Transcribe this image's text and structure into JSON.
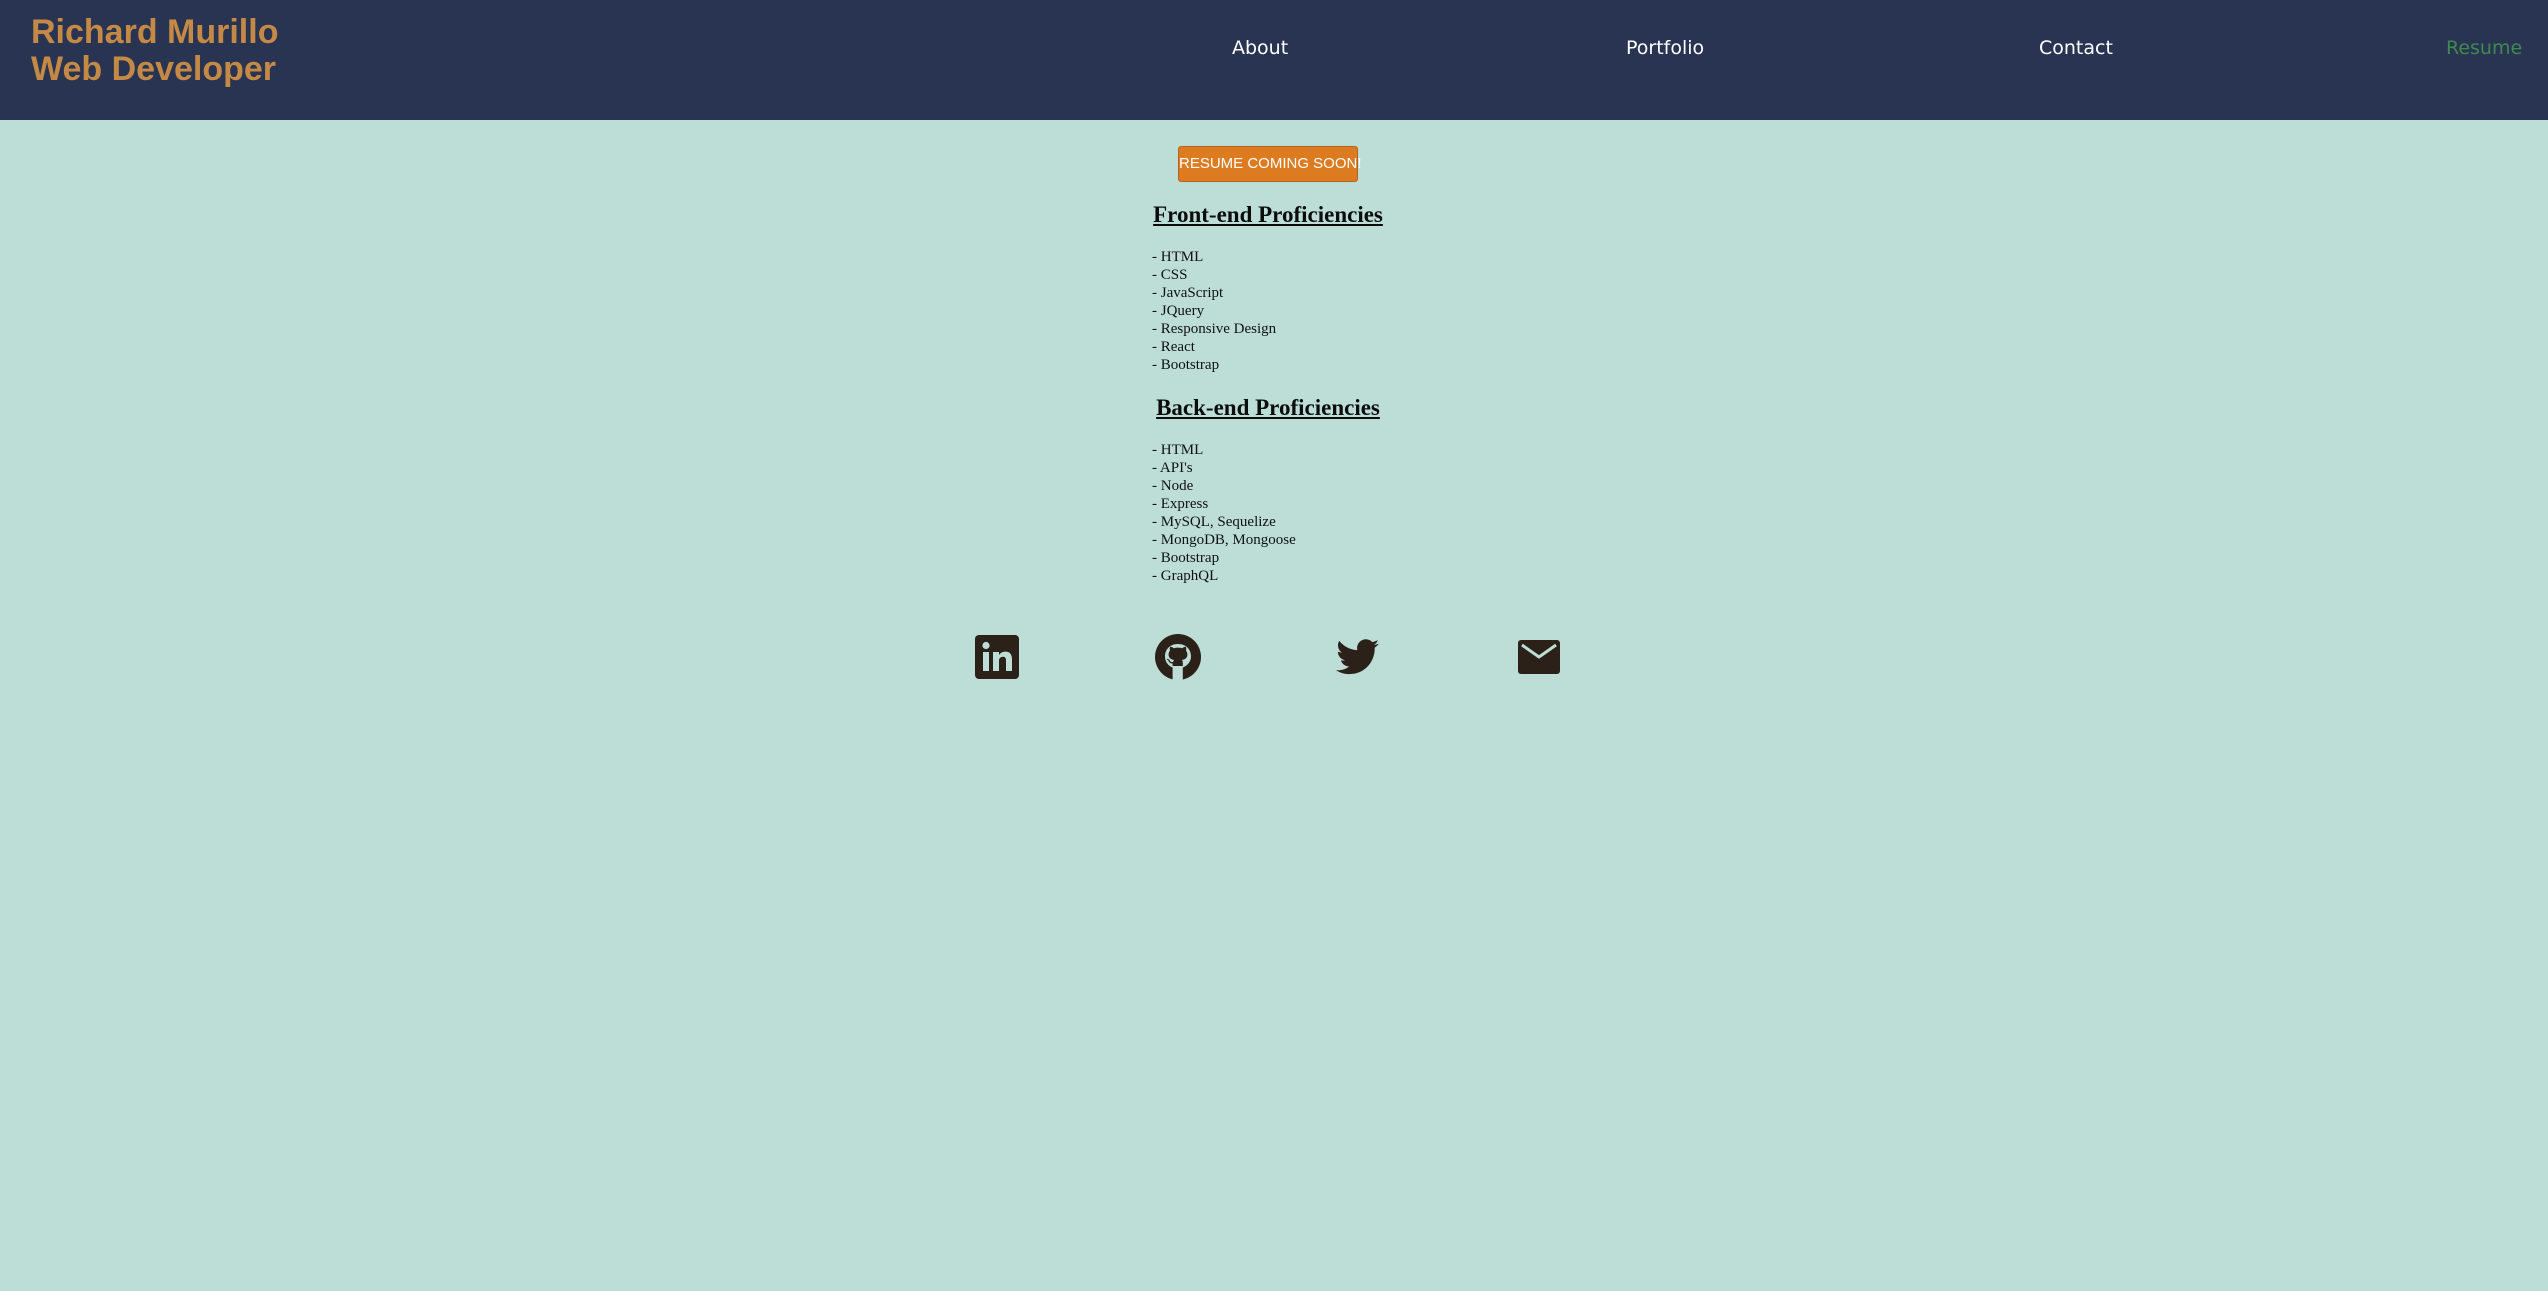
{
  "header": {
    "name": "Richard Murillo",
    "role": "Web Developer",
    "brand_color": "#c48a45",
    "background": "#283452"
  },
  "nav": {
    "items": [
      {
        "label": "About"
      },
      {
        "label": "Portfolio"
      },
      {
        "label": "Contact"
      },
      {
        "label": "Resume",
        "active": true
      }
    ],
    "active_color": "#3f8a4e"
  },
  "main": {
    "resume_button": "RESUME COMING SOON!",
    "front_end": {
      "heading": "Front-end Proficiencies",
      "items": [
        "- HTML",
        "- CSS",
        "- JavaScript",
        "- JQuery",
        "- Responsive Design",
        "- React",
        "- Bootstrap"
      ]
    },
    "back_end": {
      "heading": "Back-end Proficiencies",
      "items": [
        "- HTML",
        "- API's",
        "- Node",
        "- Express",
        "- MySQL, Sequelize",
        "- MongoDB, Mongoose",
        "- Bootstrap",
        "- GraphQL"
      ]
    }
  },
  "social": {
    "icons": [
      "linkedin-icon",
      "github-icon",
      "twitter-icon",
      "email-icon"
    ],
    "icon_color": "#2c2118"
  },
  "colors": {
    "page_background": "#bcded7",
    "button": "#dc7b1f"
  }
}
